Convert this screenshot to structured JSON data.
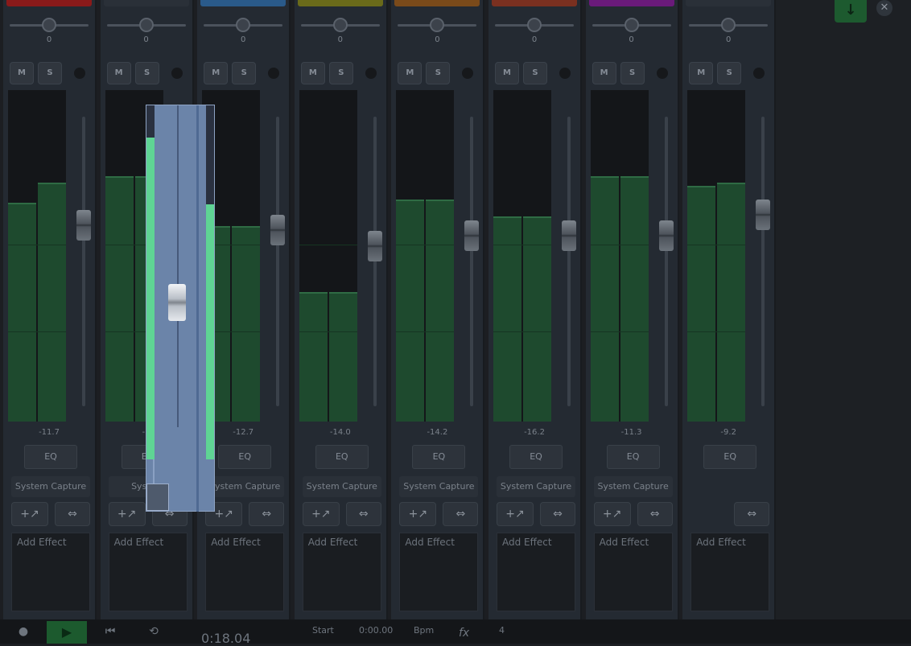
{
  "strips": [
    {
      "color": "#8a1a1a",
      "pan": "0",
      "mute": "M",
      "solo": "S",
      "level": "-11.7",
      "eq": "EQ",
      "input": "System Capture",
      "send": "+↗",
      "link": "⇔",
      "fx": "Add Effect",
      "meterL": 0.66,
      "meterR": 0.72,
      "fader": 0.64
    },
    {
      "color": "#2a3038",
      "pan": "0",
      "mute": "M",
      "solo": "S",
      "level": "-1",
      "eq": "EQ",
      "input": "System",
      "send": "+↗",
      "link": "⇔",
      "fx": "Add Effect",
      "meterL": 0.74,
      "meterR": 0.74,
      "fader": 0.5
    },
    {
      "color": "#2a5a8a",
      "pan": "0",
      "mute": "M",
      "solo": "S",
      "level": "-12.7",
      "eq": "EQ",
      "input": "System Capture",
      "send": "+↗",
      "link": "⇔",
      "fx": "Add Effect",
      "meterL": 0.59,
      "meterR": 0.59,
      "fader": 0.62
    },
    {
      "color": "#6a6a1a",
      "pan": "0",
      "mute": "M",
      "solo": "S",
      "level": "-14.0",
      "eq": "EQ",
      "input": "System Capture",
      "send": "+↗",
      "link": "⇔",
      "fx": "Add Effect",
      "meterL": 0.39,
      "meterR": 0.39,
      "fader": 0.56
    },
    {
      "color": "#7a4a1a",
      "pan": "0",
      "mute": "M",
      "solo": "S",
      "level": "-14.2",
      "eq": "EQ",
      "input": "System Capture",
      "send": "+↗",
      "link": "⇔",
      "fx": "Add Effect",
      "meterL": 0.67,
      "meterR": 0.67,
      "fader": 0.6
    },
    {
      "color": "#7a3020",
      "pan": "0",
      "mute": "M",
      "solo": "S",
      "level": "-16.2",
      "eq": "EQ",
      "input": "System Capture",
      "send": "+↗",
      "link": "⇔",
      "fx": "Add Effect",
      "meterL": 0.62,
      "meterR": 0.62,
      "fader": 0.6
    },
    {
      "color": "#6a1a7a",
      "pan": "0",
      "mute": "M",
      "solo": "S",
      "level": "-11.3",
      "eq": "EQ",
      "input": "System Capture",
      "send": "+↗",
      "link": "⇔",
      "fx": "Add Effect",
      "meterL": 0.74,
      "meterR": 0.74,
      "fader": 0.6
    },
    {
      "color": "#2a3038",
      "pan": "0",
      "mute": "M",
      "solo": "S",
      "level": "-9.2",
      "eq": "EQ",
      "input": "",
      "send": "",
      "link": "⇔",
      "fx": "Add Effect",
      "meterL": 0.71,
      "meterR": 0.72,
      "fader": 0.68
    }
  ],
  "overlay": {
    "meterL": 0.91,
    "meterR": 0.72
  },
  "header": {
    "download": "↓",
    "close": "✕"
  },
  "transport": {
    "stop": "●",
    "play": "▶",
    "skip": "⏮",
    "loop": "⟲",
    "time": "0:18.04",
    "start_label": "Start",
    "start_value": "0:00.00",
    "bpm_label": "Bpm",
    "fx_label": "fx",
    "fx_value": "4"
  }
}
